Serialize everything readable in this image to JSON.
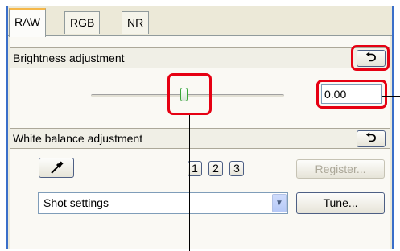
{
  "tabs": [
    {
      "label": "RAW",
      "active": true
    },
    {
      "label": "RGB",
      "active": false
    },
    {
      "label": "NR",
      "active": false
    }
  ],
  "brightness": {
    "title": "Brightness adjustment",
    "reset_icon": "reset-arrow-icon",
    "value": "0.00",
    "slider_fraction": 0.5
  },
  "white_balance": {
    "title": "White balance adjustment",
    "reset_icon": "reset-arrow-icon",
    "eyedropper_icon": "eyedropper-icon",
    "presets": [
      "1",
      "2",
      "3"
    ],
    "register_label": "Register...",
    "selected": "Shot settings",
    "tune_label": "Tune..."
  },
  "colors": {
    "highlight": "#e60012",
    "window_border": "#3b6fc9",
    "tab_accent": "#f5b74a"
  }
}
